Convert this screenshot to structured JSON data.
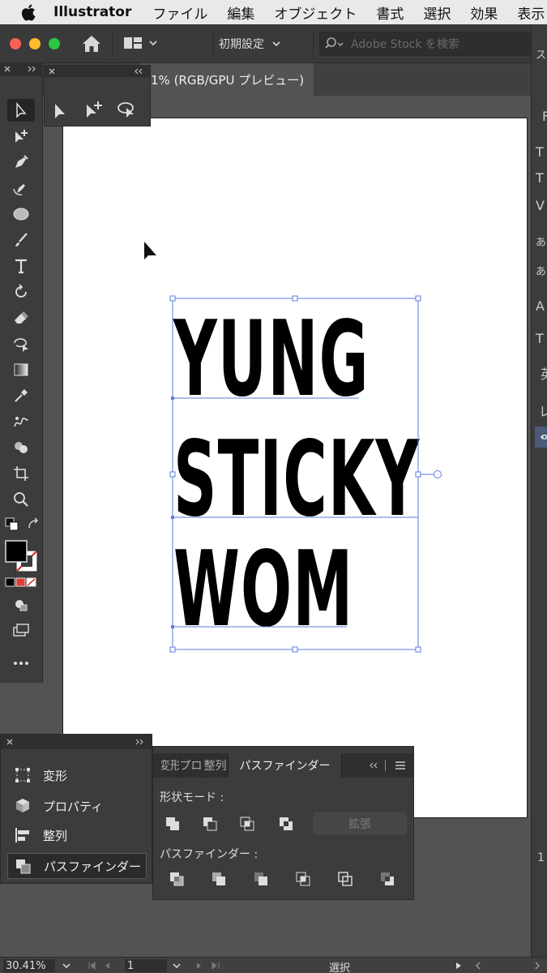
{
  "menubar": {
    "app_name": "Illustrator",
    "items": [
      "ファイル",
      "編集",
      "オブジェクト",
      "書式",
      "選択",
      "効果",
      "表示"
    ]
  },
  "appbar": {
    "workspace_label": "初期設定",
    "search_placeholder": "Adobe Stock を検索"
  },
  "document": {
    "tab_label": "1% (RGB/GPU プレビュー)"
  },
  "canvas": {
    "lines": [
      "YUNG",
      "STICKY",
      "WOM"
    ]
  },
  "left_panel": {
    "items": [
      {
        "label": "変形",
        "icon": "transform-icon"
      },
      {
        "label": "プロパティ",
        "icon": "properties-icon"
      },
      {
        "label": "整列",
        "icon": "align-icon"
      },
      {
        "label": "パスファインダー",
        "icon": "pathfinder-icon"
      }
    ],
    "active_index": 3
  },
  "pathfinder": {
    "tabs": [
      "変形",
      "プロ",
      "整列",
      "パスファインダー"
    ],
    "active_tab": "パスファインダー",
    "shape_modes_label": "形状モード :",
    "expand_label": "拡張",
    "pathfinders_label": "パスファインダー :"
  },
  "right_panel": {
    "glyphs": [
      "ス",
      "F",
      "T",
      "T",
      "V",
      "あ",
      "あ",
      "A",
      "T",
      "英",
      "レ"
    ]
  },
  "statusbar": {
    "zoom": "30.41%",
    "artboard_number": "1",
    "tool_name": "選択"
  },
  "colors": {
    "selection": "#4b6fd8",
    "panel_bg": "#3c3c3c",
    "canvas_bg": "#535353"
  }
}
